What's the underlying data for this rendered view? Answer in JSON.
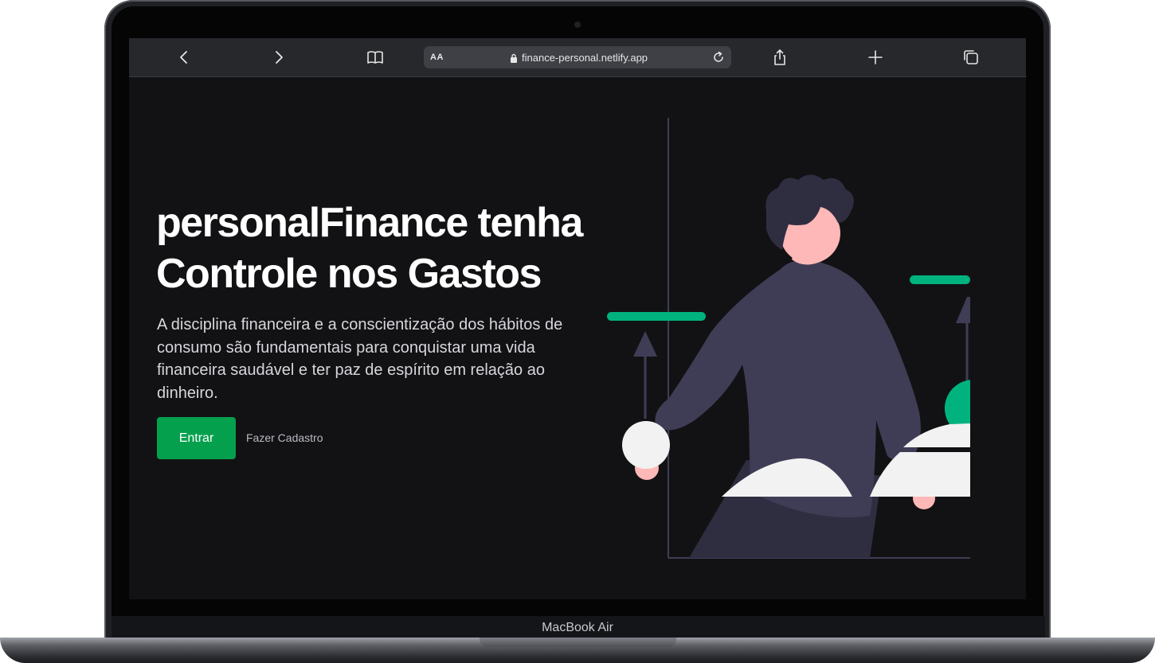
{
  "browser": {
    "back_icon": "chevron-left-icon",
    "forward_icon": "chevron-right-icon",
    "bookmarks_icon": "book-icon",
    "text_size_label": "AA",
    "url": "finance-personal.netlify.app",
    "share_icon": "share-icon",
    "new_tab_icon": "plus-icon",
    "tabs_icon": "tabs-icon"
  },
  "hero": {
    "title": "personalFinance tenha Controle nos Gastos",
    "description": "A disciplina financeira e a conscientização dos hábitos de consumo são fundamentais para conquistar uma vida financeira saudável e ter paz de espírito em relação ao dinheiro.",
    "primary_button": "Entrar",
    "secondary_link": "Fazer Cadastro"
  },
  "device": {
    "model_label": "MacBook Air"
  },
  "colors": {
    "background": "#121214",
    "accent": "#04a04d",
    "illustration_green": "#00b37e",
    "illustration_purple": "#3f3d56"
  }
}
